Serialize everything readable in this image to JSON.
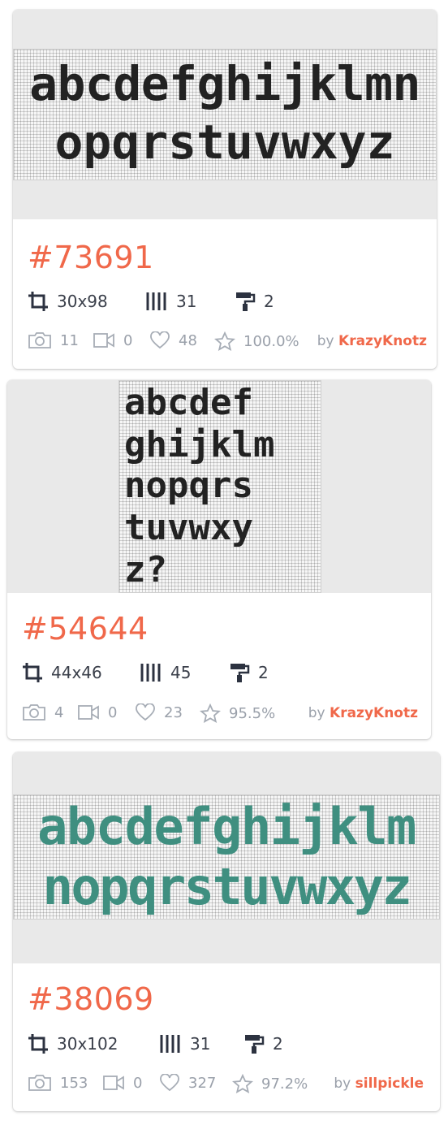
{
  "patterns": [
    {
      "id": "#73691",
      "lines": [
        "abcdefghijklmn",
        "opqrstuvwxyz"
      ],
      "glyph_color": "#222222",
      "size": "30x98",
      "strands": "31",
      "colors": "2",
      "photos": "11",
      "videos": "0",
      "likes": "48",
      "rating": "100.0%",
      "by_label": "by",
      "author": "KrazyKnotz"
    },
    {
      "id": "#54644",
      "lines": [
        "abcdef",
        "ghijklm",
        "nopqrs",
        "tuvwxy",
        "z?"
      ],
      "glyph_color": "#222222",
      "size": "44x46",
      "strands": "45",
      "colors": "2",
      "photos": "4",
      "videos": "0",
      "likes": "23",
      "rating": "95.5%",
      "by_label": "by",
      "author": "KrazyKnotz"
    },
    {
      "id": "#38069",
      "lines": [
        "abcdefghijklm",
        "nopqrstuvwxyz"
      ],
      "glyph_color": "#3f8f80",
      "size": "30x102",
      "strands": "31",
      "colors": "2",
      "photos": "153",
      "videos": "0",
      "likes": "327",
      "rating": "97.2%",
      "by_label": "by",
      "author": "sillpickle"
    }
  ],
  "icons": {
    "size": "crop-icon",
    "strands": "strands-icon",
    "colors": "paint-roller-icon",
    "photos": "camera-icon",
    "videos": "video-icon",
    "likes": "heart-icon",
    "rating": "star-icon"
  },
  "accent_color": "#f0684a"
}
